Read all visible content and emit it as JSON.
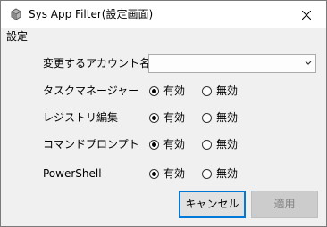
{
  "window": {
    "title": "Sys App Filter(設定画面)",
    "icon": "app-icon",
    "close_icon": "close-icon"
  },
  "menu": {
    "items": [
      "設定"
    ]
  },
  "form": {
    "account_label": "変更するアカウント名",
    "account_value": "",
    "rows": [
      {
        "label": "タスクマネージャー",
        "enabled_label": "有効",
        "disabled_label": "無効",
        "selected": "有効"
      },
      {
        "label": "レジストリ編集",
        "enabled_label": "有効",
        "disabled_label": "無効",
        "selected": "有効"
      },
      {
        "label": "コマンドプロンプト",
        "enabled_label": "有効",
        "disabled_label": "無効",
        "selected": "有効"
      },
      {
        "label": "PowerShell",
        "enabled_label": "有効",
        "disabled_label": "無効",
        "selected": "有効"
      }
    ]
  },
  "buttons": {
    "cancel": "キャンセル",
    "apply": "適用",
    "apply_enabled": false
  },
  "colors": {
    "focus_border": "#0078d7",
    "disabled_text": "#838383"
  }
}
